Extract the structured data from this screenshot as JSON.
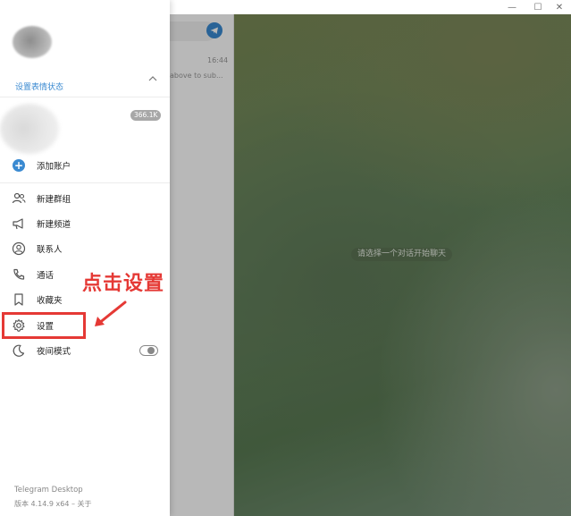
{
  "window": {
    "minimize_glyph": "—",
    "maximize_glyph": "☐",
    "close_glyph": "✕"
  },
  "chat_list": {
    "time": "16:44",
    "preview": "above to sub..."
  },
  "main": {
    "empty_state": "请选择一个对话开始聊天"
  },
  "drawer": {
    "status_link": "设置表情状态",
    "account_badge": "366.1K",
    "add_account": "添加账户",
    "menu": [
      {
        "label": "新建群组",
        "icon": "people-icon"
      },
      {
        "label": "新建频道",
        "icon": "megaphone-icon"
      },
      {
        "label": "联系人",
        "icon": "contact-icon"
      },
      {
        "label": "通话",
        "icon": "phone-icon"
      },
      {
        "label": "收藏夹",
        "icon": "bookmark-icon"
      },
      {
        "label": "设置",
        "icon": "gear-icon"
      },
      {
        "label": "夜间模式",
        "icon": "moon-icon"
      }
    ],
    "night_mode_on": false,
    "footer_app": "Telegram Desktop",
    "footer_version": "版本 4.14.9 x64 – 关于"
  },
  "annotation": {
    "text": "点击设置",
    "color": "#e53935"
  },
  "colors": {
    "accent": "#3a8ad1"
  }
}
